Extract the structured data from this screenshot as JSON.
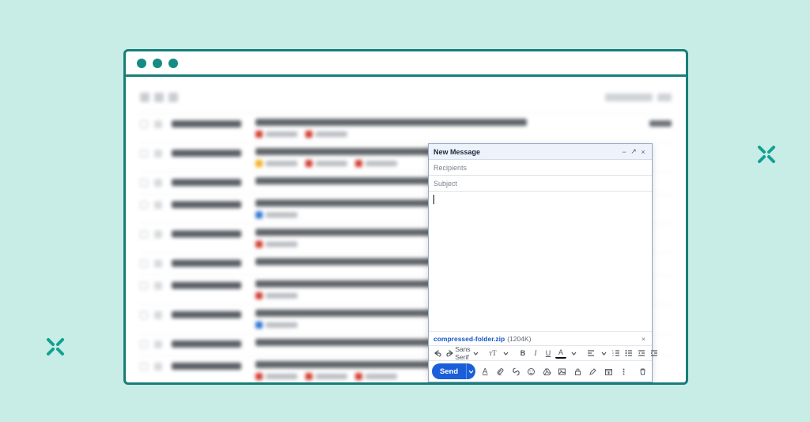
{
  "compose": {
    "title": "New Message",
    "recipients_placeholder": "Recipients",
    "subject_placeholder": "Subject",
    "attachment": {
      "filename": "compressed-folder.zip",
      "size_label": "(1204K)"
    },
    "format": {
      "font_family": "Sans Serif"
    },
    "send_label": "Send",
    "window_controls": {
      "minimize": "−",
      "popout": "↗",
      "close": "×"
    }
  },
  "icons": {
    "undo": "undo-icon",
    "redo": "redo-icon",
    "font_size": "font-size-icon",
    "bold": "B",
    "italic": "I",
    "underline": "U",
    "text_color": "A",
    "align": "align-icon",
    "list_ordered": "ordered-list-icon",
    "list_bullet": "bullet-list-icon",
    "indent_less": "indent-less-icon",
    "indent_more": "indent-more-icon",
    "format_a": "format-a-icon",
    "attach": "attach-icon",
    "link": "link-icon",
    "emoji": "emoji-icon",
    "drive": "drive-icon",
    "image": "image-icon",
    "lock": "lock-icon",
    "pen": "pen-icon",
    "calendar_insert": "calendar-insert-icon",
    "more": "more-icon",
    "trash": "trash-icon"
  }
}
